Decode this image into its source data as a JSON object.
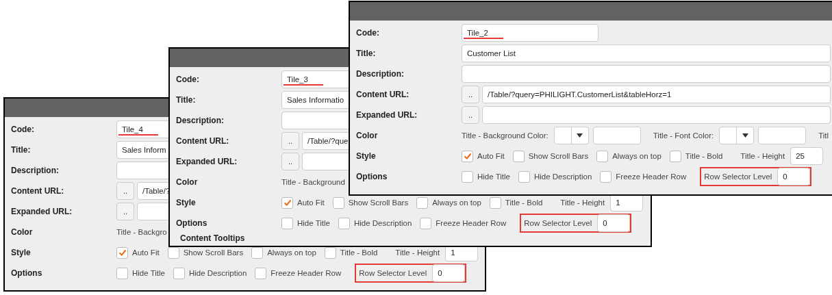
{
  "windows": [
    {
      "rows": [
        {
          "kind": "code",
          "label": "Code:",
          "value": "Tile_4",
          "annotated": true
        },
        {
          "kind": "text",
          "label": "Title:",
          "value": "Sales Inform"
        },
        {
          "kind": "text",
          "label": "Description:"
        },
        {
          "kind": "url",
          "label": "Content URL:",
          "button": "..",
          "value": "/Table/?"
        },
        {
          "kind": "url",
          "label": "Expanded URL:",
          "button": ".."
        },
        {
          "kind": "color",
          "label": "Color",
          "items": [
            {
              "kind": "label",
              "text": "Title - Backgro"
            }
          ]
        },
        {
          "kind": "checks",
          "label": "Style",
          "items": [
            {
              "kind": "check",
              "label": "Auto Fit",
              "checked": true
            },
            {
              "kind": "check",
              "label": "Show Scroll Bars",
              "checked": false
            },
            {
              "kind": "check",
              "label": "Always on top",
              "checked": false
            },
            {
              "kind": "check",
              "label": "Title - Bold",
              "checked": false
            },
            {
              "kind": "number",
              "label": "Title - Height",
              "value": "1"
            }
          ]
        },
        {
          "kind": "checks",
          "label": "Options",
          "items": [
            {
              "kind": "check",
              "label": "Hide Title",
              "checked": false
            },
            {
              "kind": "check",
              "label": "Hide Description",
              "checked": false
            },
            {
              "kind": "check",
              "label": "Freeze Header Row",
              "checked": false
            },
            {
              "kind": "number",
              "label": "Row Selector Level",
              "value": "0",
              "annotated": true
            }
          ]
        }
      ]
    },
    {
      "rows": [
        {
          "kind": "code",
          "label": "Code:",
          "value": "Tile_3",
          "annotated": true
        },
        {
          "kind": "text",
          "label": "Title:",
          "value": "Sales Informatio"
        },
        {
          "kind": "text",
          "label": "Description:"
        },
        {
          "kind": "url",
          "label": "Content URL:",
          "button": "..",
          "value": "/Table/?que"
        },
        {
          "kind": "url",
          "label": "Expanded URL:",
          "button": ".."
        },
        {
          "kind": "color",
          "label": "Color",
          "items": [
            {
              "kind": "label",
              "text": "Title - Background"
            }
          ]
        },
        {
          "kind": "checks",
          "label": "Style",
          "items": [
            {
              "kind": "check",
              "label": "Auto Fit",
              "checked": true
            },
            {
              "kind": "check",
              "label": "Show Scroll Bars",
              "checked": false
            },
            {
              "kind": "check",
              "label": "Always on top",
              "checked": false
            },
            {
              "kind": "check",
              "label": "Title - Bold",
              "checked": false
            },
            {
              "kind": "number",
              "label": "Title - Height",
              "value": "1"
            }
          ]
        },
        {
          "kind": "checks",
          "label": "Options",
          "items": [
            {
              "kind": "check",
              "label": "Hide Title",
              "checked": false
            },
            {
              "kind": "check",
              "label": "Hide Description",
              "checked": false
            },
            {
              "kind": "check",
              "label": "Freeze Header Row",
              "checked": false
            },
            {
              "kind": "number",
              "label": "Row Selector Level",
              "value": "0",
              "annotated": true
            }
          ]
        },
        {
          "kind": "section",
          "label": "Content Tooltips"
        }
      ]
    },
    {
      "rows": [
        {
          "kind": "code",
          "label": "Code:",
          "value": "Tile_2",
          "annotated": true
        },
        {
          "kind": "text",
          "label": "Title:",
          "value": "Customer List"
        },
        {
          "kind": "text",
          "label": "Description:"
        },
        {
          "kind": "url",
          "label": "Content URL:",
          "button": "..",
          "value": "/Table/?query=PHILIGHT.CustomerList&tableHorz=1"
        },
        {
          "kind": "url",
          "label": "Expanded URL:",
          "button": ".."
        },
        {
          "kind": "color",
          "label": "Color",
          "items": [
            {
              "kind": "label",
              "text": "Title - Background Color:"
            },
            {
              "kind": "picker"
            },
            {
              "kind": "field"
            },
            {
              "kind": "label",
              "text": "Title - Font Color:"
            },
            {
              "kind": "picker"
            },
            {
              "kind": "field"
            },
            {
              "kind": "label",
              "text": "Titl"
            }
          ]
        },
        {
          "kind": "checks",
          "label": "Style",
          "items": [
            {
              "kind": "check",
              "label": "Auto Fit",
              "checked": true
            },
            {
              "kind": "check",
              "label": "Show Scroll Bars",
              "checked": false
            },
            {
              "kind": "check",
              "label": "Always on top",
              "checked": false
            },
            {
              "kind": "check",
              "label": "Title - Bold",
              "checked": false
            },
            {
              "kind": "number",
              "label": "Title - Height",
              "value": "25"
            }
          ]
        },
        {
          "kind": "checks",
          "label": "Options",
          "items": [
            {
              "kind": "check",
              "label": "Hide Title",
              "checked": false
            },
            {
              "kind": "check",
              "label": "Hide Description",
              "checked": false
            },
            {
              "kind": "check",
              "label": "Freeze Header Row",
              "checked": false
            },
            {
              "kind": "number",
              "label": "Row Selector Level",
              "value": "0",
              "annotated": true
            }
          ]
        }
      ]
    }
  ]
}
